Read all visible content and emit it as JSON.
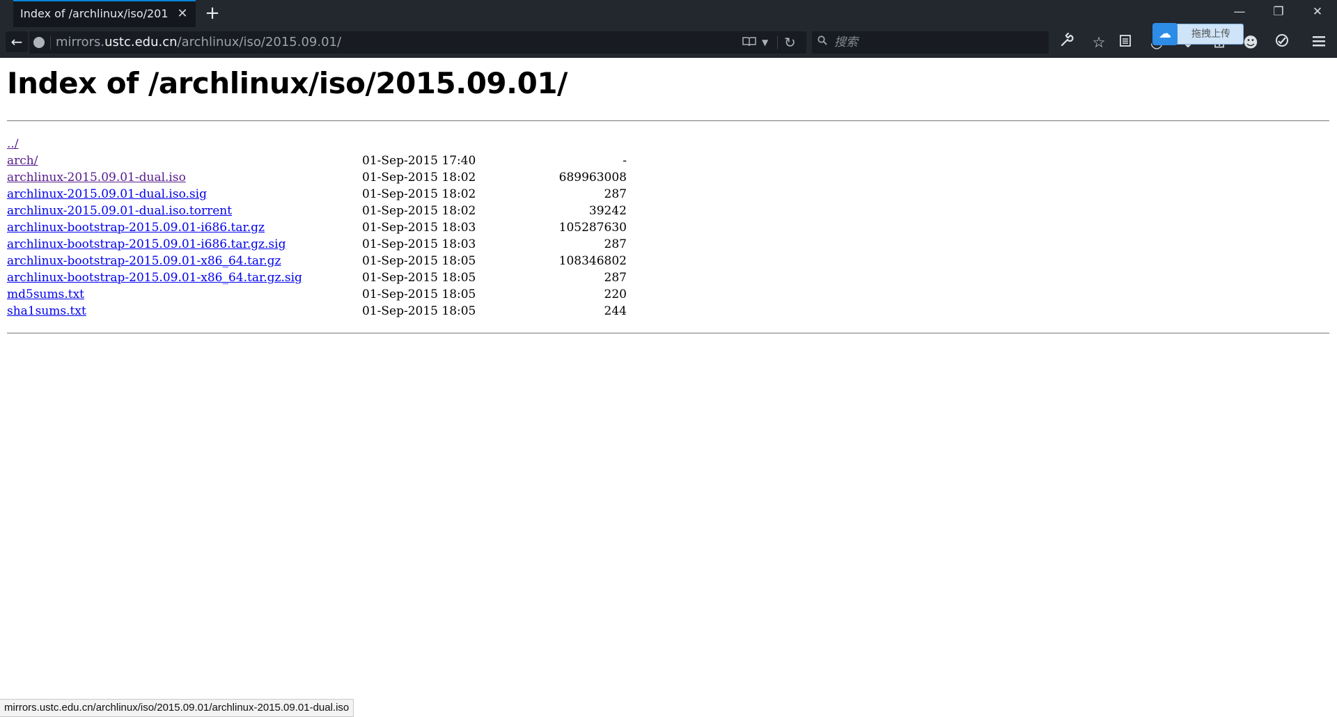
{
  "browser": {
    "tab_title": "Index of /archlinux/iso/201...",
    "tab_close_glyph": "✕",
    "new_tab_glyph": "+",
    "window_controls": {
      "minimize": "—",
      "restore": "❐",
      "close": "✕"
    },
    "url": {
      "host_prefix": "mirrors.",
      "host_domain": "ustc.edu.cn",
      "path": "/archlinux/iso/2015.09.01/"
    },
    "search_placeholder": "搜索",
    "upload_widget_label": "拖拽上传",
    "toolbar_icons": [
      "wrench-icon",
      "star-icon",
      "reading-list-icon",
      "pocket-icon",
      "download-icon",
      "extension-icon",
      "smiley-icon",
      "sync-icon",
      "hamburger-menu-icon"
    ]
  },
  "page": {
    "heading": "Index of /archlinux/iso/2015.09.01/",
    "entries": [
      {
        "name": "../",
        "date": "",
        "size": "",
        "visited": true
      },
      {
        "name": "arch/",
        "date": "01-Sep-2015 17:40",
        "size": "-",
        "visited": true
      },
      {
        "name": "archlinux-2015.09.01-dual.iso",
        "date": "01-Sep-2015 18:02",
        "size": "689963008",
        "visited": true
      },
      {
        "name": "archlinux-2015.09.01-dual.iso.sig",
        "date": "01-Sep-2015 18:02",
        "size": "287",
        "visited": false
      },
      {
        "name": "archlinux-2015.09.01-dual.iso.torrent",
        "date": "01-Sep-2015 18:02",
        "size": "39242",
        "visited": false
      },
      {
        "name": "archlinux-bootstrap-2015.09.01-i686.tar.gz",
        "date": "01-Sep-2015 18:03",
        "size": "105287630",
        "visited": false
      },
      {
        "name": "archlinux-bootstrap-2015.09.01-i686.tar.gz.sig",
        "date": "01-Sep-2015 18:03",
        "size": "287",
        "visited": false
      },
      {
        "name": "archlinux-bootstrap-2015.09.01-x86_64.tar.gz",
        "date": "01-Sep-2015 18:05",
        "size": "108346802",
        "visited": false
      },
      {
        "name": "archlinux-bootstrap-2015.09.01-x86_64.tar.gz.sig",
        "date": "01-Sep-2015 18:05",
        "size": "287",
        "visited": false
      },
      {
        "name": "md5sums.txt",
        "date": "01-Sep-2015 18:05",
        "size": "220",
        "visited": false
      },
      {
        "name": "sha1sums.txt",
        "date": "01-Sep-2015 18:05",
        "size": "244",
        "visited": false
      }
    ]
  },
  "status_bar": {
    "text": "mirrors.ustc.edu.cn/archlinux/iso/2015.09.01/archlinux-2015.09.01-dual.iso"
  },
  "colors": {
    "chrome_bg": "#23282f",
    "tab_active_accent": "#0a84d8",
    "link": "#0000ee",
    "link_visited": "#551a8b"
  }
}
